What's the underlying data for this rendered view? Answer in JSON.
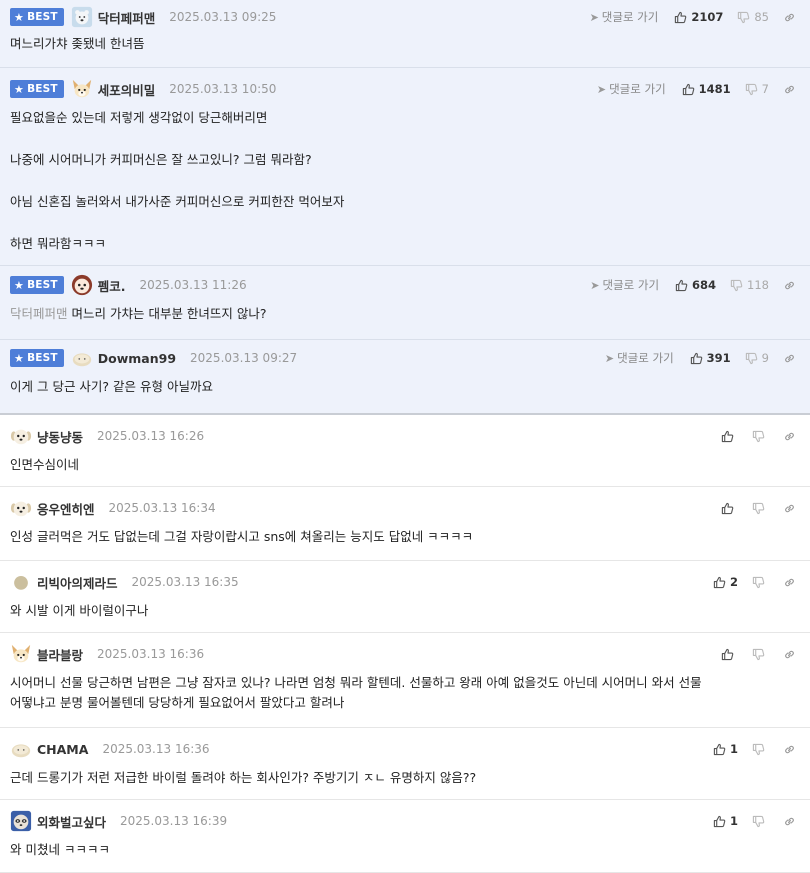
{
  "ui": {
    "best_label": "BEST",
    "reply_label": "댓글로 가기"
  },
  "colors": {
    "best_badge": "#4e7ed8",
    "best_background": "#eef2fb"
  },
  "comments": [
    {
      "best": true,
      "avatar": "polar-bear-avatar",
      "nickname": "닥터페퍼맨",
      "date": "2025.03.13 09:25",
      "up": "2107",
      "down": "85",
      "mention": "",
      "lines": [
        "며느리가챠 좆됐네 한녀뜸"
      ]
    },
    {
      "best": true,
      "avatar": "fennec-fox-avatar",
      "nickname": "세포의비밀",
      "date": "2025.03.13 10:50",
      "up": "1481",
      "down": "7",
      "mention": "",
      "lines": [
        "필요없을순 있는데 저렇게 생각없이 당근해버리면",
        "",
        "나중에 시어머니가 커피머신은 잘 쓰고있니? 그럼 뭐라함?",
        "",
        "아님 신혼집 놀러와서 내가사준 커피머신으로 커피한잔 먹어보자",
        "",
        "하면 뭐라함ㅋㅋㅋ"
      ]
    },
    {
      "best": true,
      "avatar": "dog-face-avatar",
      "nickname": "펨코.",
      "date": "2025.03.13 11:26",
      "up": "684",
      "down": "118",
      "mention": "닥터페퍼맨",
      "lines": [
        "며느리 가챠는 대부분 한녀뜨지 않나?"
      ]
    },
    {
      "best": true,
      "avatar": "default-blob-avatar",
      "nickname": "Dowman99",
      "date": "2025.03.13 09:27",
      "up": "391",
      "down": "9",
      "mention": "",
      "lines": [
        "이게 그 당근 사기? 같은 유형 아닐까요"
      ]
    },
    {
      "best": false,
      "avatar": "puppy-avatar",
      "nickname": "냥동냥동",
      "date": "2025.03.13 16:26",
      "up": "",
      "down": "",
      "mention": "",
      "lines": [
        "인면수심이네"
      ]
    },
    {
      "best": false,
      "avatar": "puppy-avatar",
      "nickname": "응우엔히엔",
      "date": "2025.03.13 16:34",
      "up": "",
      "down": "",
      "mention": "",
      "lines": [
        "인성 글러먹은 거도 답없는데 그걸 자랑이랍시고 sns에 쳐올리는 능지도 답없네 ㅋㅋㅋㅋ"
      ]
    },
    {
      "best": false,
      "avatar": "default-dot-avatar",
      "nickname": "리빅아의제라드",
      "date": "2025.03.13 16:35",
      "up": "2",
      "down": "",
      "mention": "",
      "lines": [
        "와 시발 이게 바이럴이구나"
      ]
    },
    {
      "best": false,
      "avatar": "fennec-fox-avatar",
      "nickname": "블라블랑",
      "date": "2025.03.13 16:36",
      "up": "",
      "down": "",
      "mention": "",
      "lines": [
        "시어머니 선물 당근하면 남편은 그냥 잠자코 있나? 나라면 엄청 뭐라 할텐데. 선물하고 왕래 아예 없을것도 아닌데 시어머니 와서 선물",
        "어떻냐고 분명 물어볼텐데 당당하게 필요없어서 팔았다고 할려나"
      ]
    },
    {
      "best": false,
      "avatar": "default-blob-avatar",
      "nickname": "CHAMA",
      "date": "2025.03.13 16:36",
      "up": "1",
      "down": "",
      "mention": "",
      "lines": [
        "근데 드롱기가 저런 저급한 바이럴 돌려야 하는 회사인가? 주방기기 ㅈㄴ 유명하지 않음??"
      ]
    },
    {
      "best": false,
      "avatar": "raccoon-avatar",
      "nickname": "외화벌고싶다",
      "date": "2025.03.13 16:39",
      "up": "1",
      "down": "",
      "mention": "",
      "lines": [
        "와 미쳤네 ㅋㅋㅋㅋ"
      ]
    }
  ]
}
